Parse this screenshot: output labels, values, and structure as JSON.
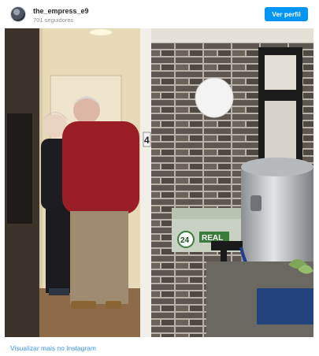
{
  "header": {
    "username": "the_empress_e9",
    "followers": "701 seguidores",
    "follow_label": "Ver perfil"
  },
  "photo": {
    "door_number": "4",
    "crate_number": "24",
    "crate_brand": "REAL"
  },
  "footer": {
    "link_text": "Visualizar mais no Instagram"
  },
  "colors": {
    "accent": "#0095f6",
    "link": "#3897f0"
  }
}
